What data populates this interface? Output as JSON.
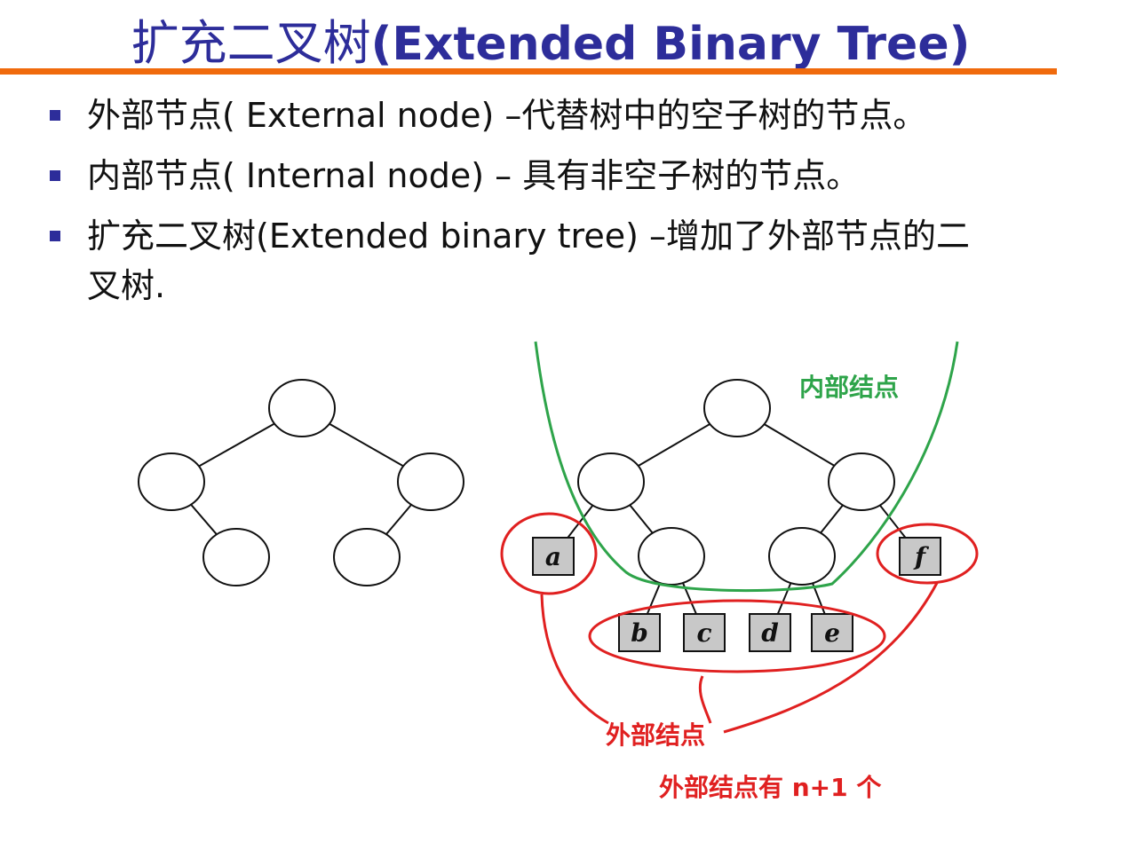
{
  "title": {
    "cn": "扩充二叉树",
    "en": "(Extended Binary Tree)"
  },
  "bullets": [
    {
      "text": "外部节点( External node) –代替树中的空子树的节点。"
    },
    {
      "text": "内部节点( Internal node) – 具有非空子树的节点。"
    },
    {
      "text": "扩充二叉树(Extended binary tree) –增加了外部节点的二叉树."
    }
  ],
  "diagram": {
    "external_node_labels": [
      "a",
      "b",
      "c",
      "d",
      "e",
      "f"
    ],
    "internal_label": "内部结点",
    "external_label": "外部结点",
    "count_label": "外部结点有 n+1 个",
    "colors": {
      "internal_curve": "#2ea44a",
      "external_marks": "#e02020",
      "external_box": "#c8c8c8",
      "title": "#2d2d9a",
      "rule": "#f06a0c"
    }
  }
}
